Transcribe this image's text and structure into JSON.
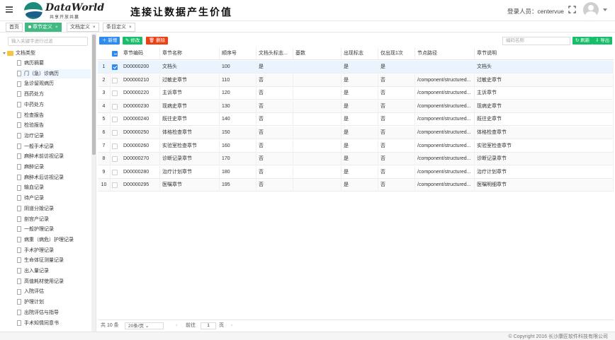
{
  "header": {
    "logo_title": "DataWorld",
    "logo_sub": "共享开放共赢",
    "slogan": "连接让数据产生价值",
    "login_label": "登录人员：centervue"
  },
  "tabs": [
    {
      "label": "首页"
    },
    {
      "label": "章节定义",
      "active": true
    },
    {
      "label": "文档定义"
    },
    {
      "label": "条目定义"
    }
  ],
  "sidebar": {
    "filter_placeholder": "输入关键字进行过滤",
    "root_label": "文档类型",
    "items": [
      "病历摘要",
      "门（急）诊病历",
      "急诊留观病历",
      "西药处方",
      "中药处方",
      "检查报告",
      "检验报告",
      "治疗记录",
      "一般手术记录",
      "麻醉术前访视记录",
      "麻醉记录",
      "麻醉术后访视记录",
      "输血记录",
      "待产记录",
      "阴道分娩记录",
      "剖宫产记录",
      "一般护理记录",
      "病重（病危）护理记录",
      "手术护理记录",
      "生命体征测量记录",
      "出入量记录",
      "高值耗材使用记录",
      "入院评估",
      "护理计划",
      "出院评估与指导",
      "手术知情同意书"
    ],
    "selected_index": 1
  },
  "toolbar": {
    "add": "新增",
    "edit": "修改",
    "delete": "删除",
    "search_placeholder": "编码名称",
    "refresh": "刷新",
    "export": "导出"
  },
  "table": {
    "headers": [
      "章节编码",
      "章节名称",
      "顺序号",
      "文档头标志...",
      "基数",
      "出现标志",
      "仅出现1次",
      "节点路径",
      "章节说明"
    ],
    "rows": [
      {
        "no": "1",
        "code": "D00000200",
        "name": "文档头",
        "order": "100",
        "doc_head": "是",
        "base": "",
        "appear": "是",
        "once": "是",
        "path": "",
        "desc": "文档头",
        "checked": true
      },
      {
        "no": "2",
        "code": "D00000210",
        "name": "过敏史章节",
        "order": "110",
        "doc_head": "否",
        "base": "",
        "appear": "是",
        "once": "否",
        "path": "/component/structured...",
        "desc": "过敏史章节",
        "checked": false
      },
      {
        "no": "3",
        "code": "D00000220",
        "name": "主诉章节",
        "order": "120",
        "doc_head": "否",
        "base": "",
        "appear": "是",
        "once": "否",
        "path": "/component/structured...",
        "desc": "主诉章节",
        "checked": false
      },
      {
        "no": "4",
        "code": "D00000230",
        "name": "现病史章节",
        "order": "130",
        "doc_head": "否",
        "base": "",
        "appear": "是",
        "once": "否",
        "path": "/component/structured...",
        "desc": "现病史章节",
        "checked": false
      },
      {
        "no": "5",
        "code": "D00000240",
        "name": "既往史章节",
        "order": "140",
        "doc_head": "否",
        "base": "",
        "appear": "是",
        "once": "否",
        "path": "/component/structured...",
        "desc": "既往史章节",
        "checked": false
      },
      {
        "no": "6",
        "code": "D00000250",
        "name": "体格检查章节",
        "order": "150",
        "doc_head": "否",
        "base": "",
        "appear": "是",
        "once": "否",
        "path": "/component/structured...",
        "desc": "体格检查章节",
        "checked": false
      },
      {
        "no": "7",
        "code": "D00000260",
        "name": "实验室检查章节",
        "order": "160",
        "doc_head": "否",
        "base": "",
        "appear": "是",
        "once": "否",
        "path": "/component/structured...",
        "desc": "实验室检查章节",
        "checked": false
      },
      {
        "no": "8",
        "code": "D00000270",
        "name": "诊断记录章节",
        "order": "170",
        "doc_head": "否",
        "base": "",
        "appear": "是",
        "once": "否",
        "path": "/component/structured...",
        "desc": "诊断记录章节",
        "checked": false
      },
      {
        "no": "9",
        "code": "D00000280",
        "name": "治疗计划章节",
        "order": "180",
        "doc_head": "否",
        "base": "",
        "appear": "是",
        "once": "否",
        "path": "/component/structured...",
        "desc": "治疗计划章节",
        "checked": false
      },
      {
        "no": "10",
        "code": "D00000295",
        "name": "医嘱章节",
        "order": "195",
        "doc_head": "否",
        "base": "",
        "appear": "是",
        "once": "否",
        "path": "/component/structured...",
        "desc": "医嘱明细章节",
        "checked": false
      }
    ]
  },
  "pager": {
    "total": "共 10 条",
    "page_size": "20条/页",
    "goto_label": "前往",
    "page": "1",
    "page_unit": "页"
  },
  "footer": {
    "copyright": "© Copyright 2016 长沙康匠软件科技有限公司"
  },
  "colors": {
    "primary": "#2d8cf0",
    "success": "#19be6b",
    "danger": "#ed4014",
    "tab_active": "#42b983"
  }
}
